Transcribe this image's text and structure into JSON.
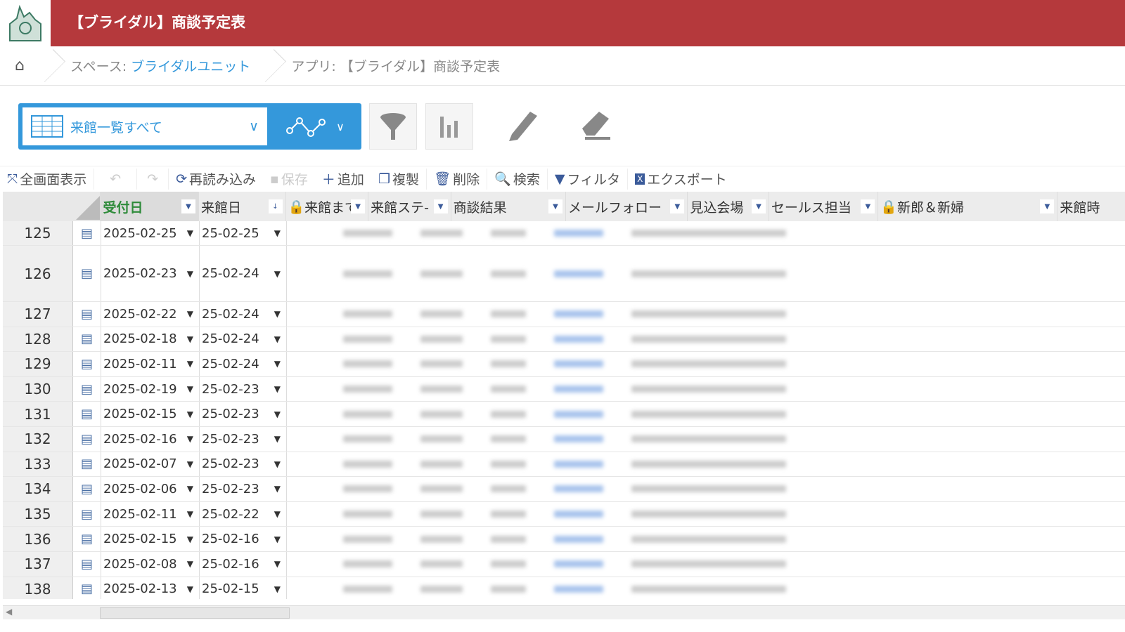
{
  "header": {
    "title": "【ブライダル】商談予定表"
  },
  "breadcrumb": {
    "space_label": "スペース: ",
    "space_link": "ブライダルユニット",
    "app": "アプリ: 【ブライダル】商談予定表"
  },
  "view": {
    "selected": "来館一覧すべて"
  },
  "toolbar": {
    "fullscreen": "全画面表示",
    "reload": "再読み込み",
    "save": "保存",
    "add": "追加",
    "copy": "複製",
    "delete": "削除",
    "search": "検索",
    "filter": "フィルタ",
    "export": "エクスポート"
  },
  "columns": [
    "受付日",
    "来館日",
    "来館まで",
    "来館ステ-",
    "商談結果",
    "メールフォロー",
    "見込会場",
    "セールス担当",
    "新郎＆新婦",
    "来館時"
  ],
  "rows": [
    {
      "no": "125",
      "received": "2025-02-25",
      "visit": "25-02-25"
    },
    {
      "no": "126",
      "received": "2025-02-23",
      "visit": "25-02-24"
    },
    {
      "no": "127",
      "received": "2025-02-22",
      "visit": "25-02-24"
    },
    {
      "no": "128",
      "received": "2025-02-18",
      "visit": "25-02-24"
    },
    {
      "no": "129",
      "received": "2025-02-11",
      "visit": "25-02-24"
    },
    {
      "no": "130",
      "received": "2025-02-19",
      "visit": "25-02-23"
    },
    {
      "no": "131",
      "received": "2025-02-15",
      "visit": "25-02-23"
    },
    {
      "no": "132",
      "received": "2025-02-16",
      "visit": "25-02-23"
    },
    {
      "no": "133",
      "received": "2025-02-07",
      "visit": "25-02-23"
    },
    {
      "no": "134",
      "received": "2025-02-06",
      "visit": "25-02-23"
    },
    {
      "no": "135",
      "received": "2025-02-11",
      "visit": "25-02-22"
    },
    {
      "no": "136",
      "received": "2025-02-15",
      "visit": "25-02-16"
    },
    {
      "no": "137",
      "received": "2025-02-08",
      "visit": "25-02-16"
    },
    {
      "no": "138",
      "received": "2025-02-13",
      "visit": "25-02-15"
    }
  ]
}
